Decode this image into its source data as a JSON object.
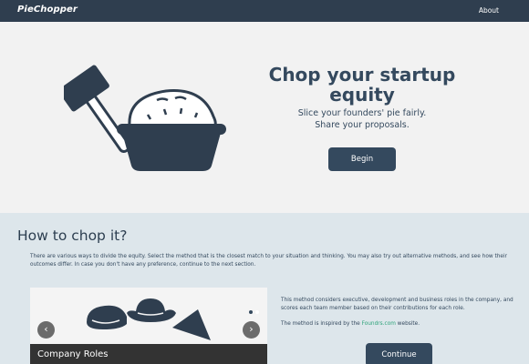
{
  "navbar": {
    "brand": "PieChopper",
    "about": "About"
  },
  "hero": {
    "title": "Chop your startup equity",
    "subtitle_line1": "Slice your founders' pie fairly.",
    "subtitle_line2": "Share your proposals.",
    "begin_label": "Begin"
  },
  "section": {
    "title": "How to chop it?",
    "description": "There are various ways to divide the equity. Select the method that is the closest match to your situation and thinking. You may also try out alternative methods, and see how their outcomes differ. In case you don't have any preference, continue to the next section.",
    "carousel": {
      "prev": "‹",
      "next": "›",
      "caption": "Company Roles"
    },
    "method_text_1": "This method considers executive, development and business roles in the company, and scores each team member based on their contributions for each role.",
    "method_text_2_before": "The method is inspired by the ",
    "method_link": "Foundrs.com",
    "method_text_2_after": " website.",
    "continue_label": "Continue"
  },
  "colors": {
    "navbar": "#2f3e4f",
    "primary": "#34495e",
    "section_bg": "#dde6eb",
    "link": "#2ea37a"
  }
}
